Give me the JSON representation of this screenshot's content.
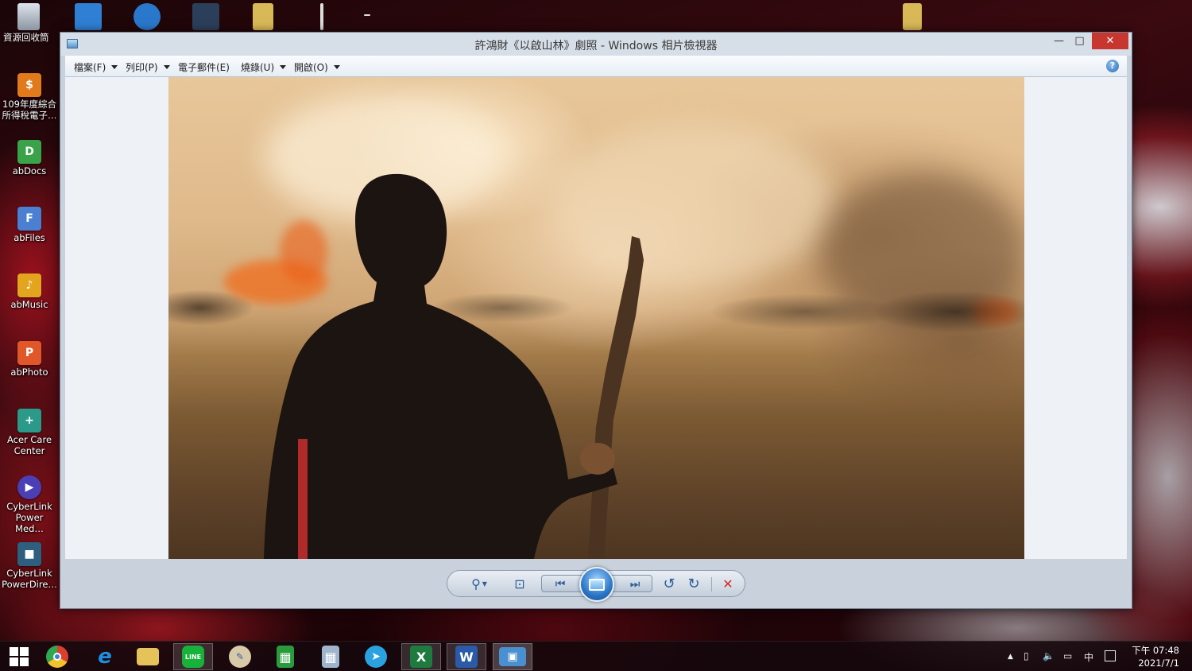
{
  "desktop": {
    "recycle_bin": "資源回收筒",
    "icons": [
      {
        "label": "109年度綜合\n所得稅電子…",
        "glyph": "$",
        "color": "#e07a1a"
      },
      {
        "label": "abDocs",
        "glyph": "D",
        "color": "#3aa34a"
      },
      {
        "label": "abFiles",
        "glyph": "F",
        "color": "#4a7fd1"
      },
      {
        "label": "abMusic",
        "glyph": "♪",
        "color": "#e3a51d"
      },
      {
        "label": "abPhoto",
        "glyph": "P",
        "color": "#e0582a"
      },
      {
        "label": "Acer Care\nCenter",
        "glyph": "+",
        "color": "#2b9a8a"
      },
      {
        "label": "CyberLink\nPower Med…",
        "glyph": "▶",
        "color": "#4b3fb5"
      },
      {
        "label": "CyberLink\nPowerDire…",
        "glyph": "■",
        "color": "#2f5f7f"
      }
    ]
  },
  "window": {
    "title": "許鴻財《以啟山林》劇照 - Windows 相片檢視器",
    "minimize": "—",
    "maximize": "□",
    "close": "✕",
    "menu": [
      "檔案(F)",
      "列印(P)",
      "電子郵件(E)",
      "燒錄(U)",
      "開啟(O)"
    ],
    "help": "?"
  },
  "controls": {
    "zoom": "⚲",
    "fit": "⊡",
    "previous": "⏮",
    "next": "⏭",
    "rotate_ccw": "↺",
    "rotate_cw": "↻",
    "delete": "✕"
  },
  "taskbar": {
    "apps": [
      {
        "name": "chrome",
        "glyph": "●",
        "color": "#d9412f"
      },
      {
        "name": "internet-explorer",
        "glyph": "e",
        "color": "#1c8fe0"
      },
      {
        "name": "file-explorer",
        "glyph": "▤",
        "color": "#e6c25a"
      },
      {
        "name": "line",
        "glyph": "LINE",
        "color": "#18b13a"
      },
      {
        "name": "paint",
        "glyph": "✎",
        "color": "#6b93c8"
      },
      {
        "name": "spreadsheet",
        "glyph": "▦",
        "color": "#2a9b3c"
      },
      {
        "name": "calculator",
        "glyph": "▦",
        "color": "#7f9bb8"
      },
      {
        "name": "telegram",
        "glyph": "➤",
        "color": "#2aa2e0"
      },
      {
        "name": "excel",
        "glyph": "X",
        "color": "#1f7a3f"
      },
      {
        "name": "word",
        "glyph": "W",
        "color": "#2a5aa8"
      },
      {
        "name": "photo-viewer",
        "glyph": "▣",
        "color": "#4a8fcf"
      }
    ],
    "tray": {
      "ime": "中",
      "time": "下午 07:48",
      "date": "2021/7/1"
    }
  }
}
